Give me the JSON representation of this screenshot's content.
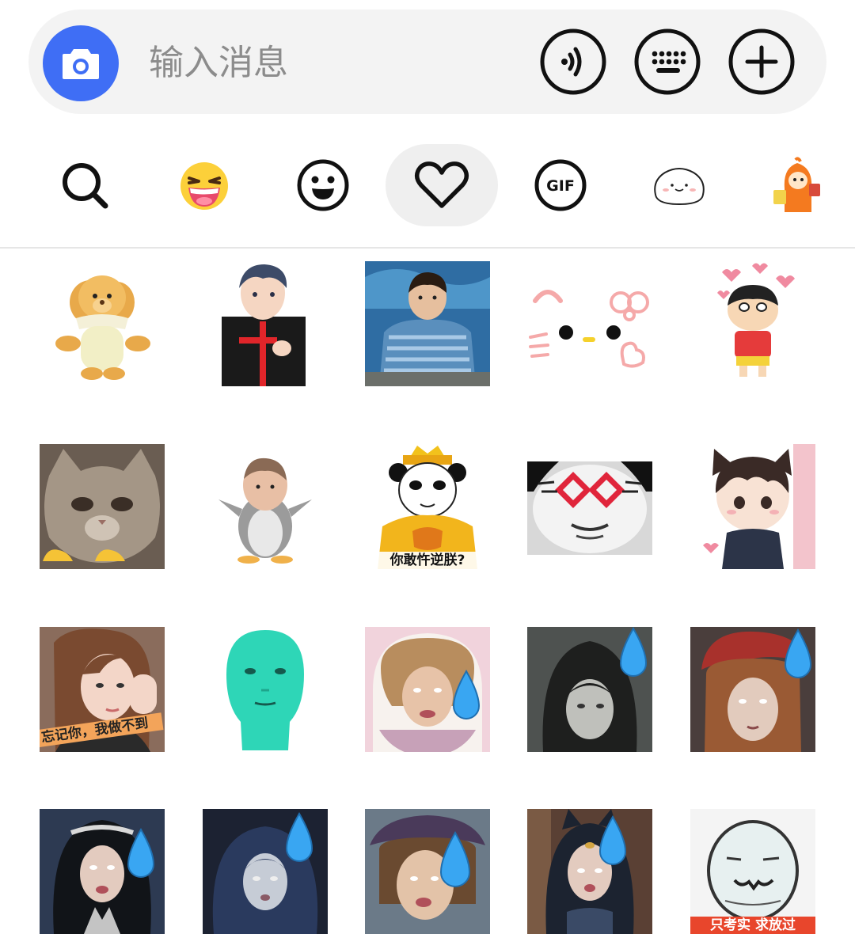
{
  "input_bar": {
    "placeholder": "输入消息",
    "icons": [
      "camera-icon",
      "voice-icon",
      "keyboard-icon",
      "plus-icon"
    ],
    "camera_color": "#3f6ef5"
  },
  "tabs": [
    {
      "name": "search",
      "icon": "search-icon"
    },
    {
      "name": "laughing-emoji",
      "icon": "laughing-face-icon"
    },
    {
      "name": "emoji",
      "icon": "smiley-icon"
    },
    {
      "name": "favorites",
      "icon": "heart-icon",
      "selected": true
    },
    {
      "name": "gif",
      "icon": "gif-icon",
      "label": "GIF"
    },
    {
      "name": "bun-stickers",
      "icon": "bun-face-icon"
    },
    {
      "name": "character-stickers",
      "icon": "orange-character-icon"
    }
  ],
  "stickers": [
    {
      "name": "puppy-plush"
    },
    {
      "name": "anime-boy"
    },
    {
      "name": "boy-striped-shirt"
    },
    {
      "name": "cute-cat-face"
    },
    {
      "name": "crayon-shin-chan"
    },
    {
      "name": "cat-closeup"
    },
    {
      "name": "penguin-face"
    },
    {
      "name": "panda-emperor",
      "caption": "你敢忤逆朕?"
    },
    {
      "name": "panda-glasses"
    },
    {
      "name": "chibi-catboy"
    },
    {
      "name": "girl-photo",
      "caption": "忘记你，我做不到"
    },
    {
      "name": "green-head"
    },
    {
      "name": "maid-sweat"
    },
    {
      "name": "hooded-sweat"
    },
    {
      "name": "red-beret-sweat"
    },
    {
      "name": "dark-hair-sweat"
    },
    {
      "name": "blue-hair-sweat"
    },
    {
      "name": "hat-sweat"
    },
    {
      "name": "hooded-ears-sweat"
    },
    {
      "name": "sketch-face",
      "caption": "只考实 求放过"
    }
  ]
}
